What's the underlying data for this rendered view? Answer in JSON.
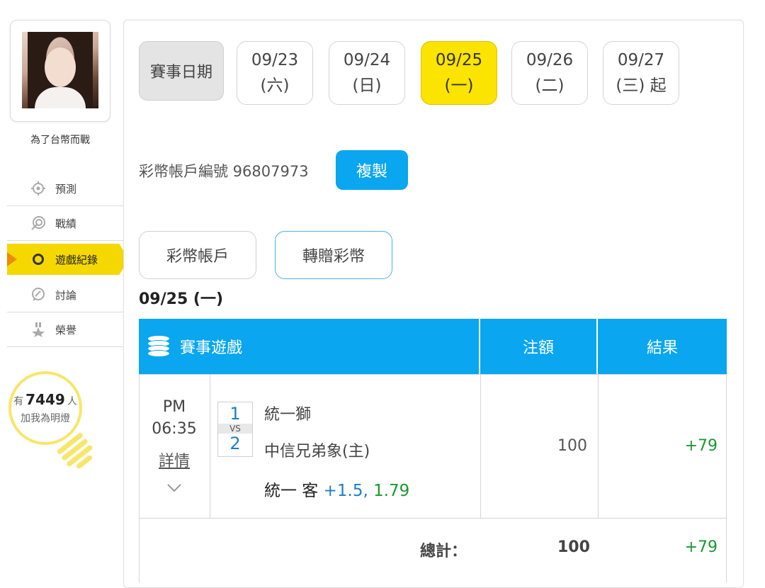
{
  "sidebar": {
    "username": "為了台幣而戰",
    "items": [
      {
        "label": "預測",
        "icon": "crosshair-icon"
      },
      {
        "label": "戰績",
        "icon": "target-icon"
      },
      {
        "label": "遊戲紀錄",
        "icon": "ring-icon"
      },
      {
        "label": "討論",
        "icon": "chat-icon"
      },
      {
        "label": "榮譽",
        "icon": "medal-icon"
      }
    ],
    "fans": {
      "prefix": "有",
      "count": "7449",
      "suffix": "人",
      "line2": "加我為明燈"
    }
  },
  "dates": {
    "label": "賽事日期",
    "tabs": [
      {
        "date": "09/23",
        "weekday": "(六)"
      },
      {
        "date": "09/24",
        "weekday": "(日)"
      },
      {
        "date": "09/25",
        "weekday": "(一)"
      },
      {
        "date": "09/26",
        "weekday": "(二)"
      },
      {
        "date": "09/27",
        "weekday": "(三) 起"
      }
    ],
    "selected_index": 2
  },
  "account": {
    "label": "彩幣帳戶編號 96807973",
    "copy_label": "複製"
  },
  "tabs": {
    "wallet": "彩幣帳戶",
    "transfer": "轉贈彩幣"
  },
  "day_title": "09/25 (一)",
  "table": {
    "headers": {
      "game": "賽事遊戲",
      "amount": "注額",
      "result": "結果"
    },
    "row": {
      "ampm": "PM",
      "time": "06:35",
      "detail": "詳情",
      "n1": "1",
      "vs": "VS",
      "n2": "2",
      "team1": "統一獅",
      "team2": "中信兄弟象(主)",
      "pick_team": "統一 客",
      "pick_line": "+1.5,",
      "pick_odds": "1.79",
      "amount": "100",
      "result": "+79"
    },
    "total": {
      "label": "總計：",
      "amount": "100",
      "result": "+79"
    }
  }
}
